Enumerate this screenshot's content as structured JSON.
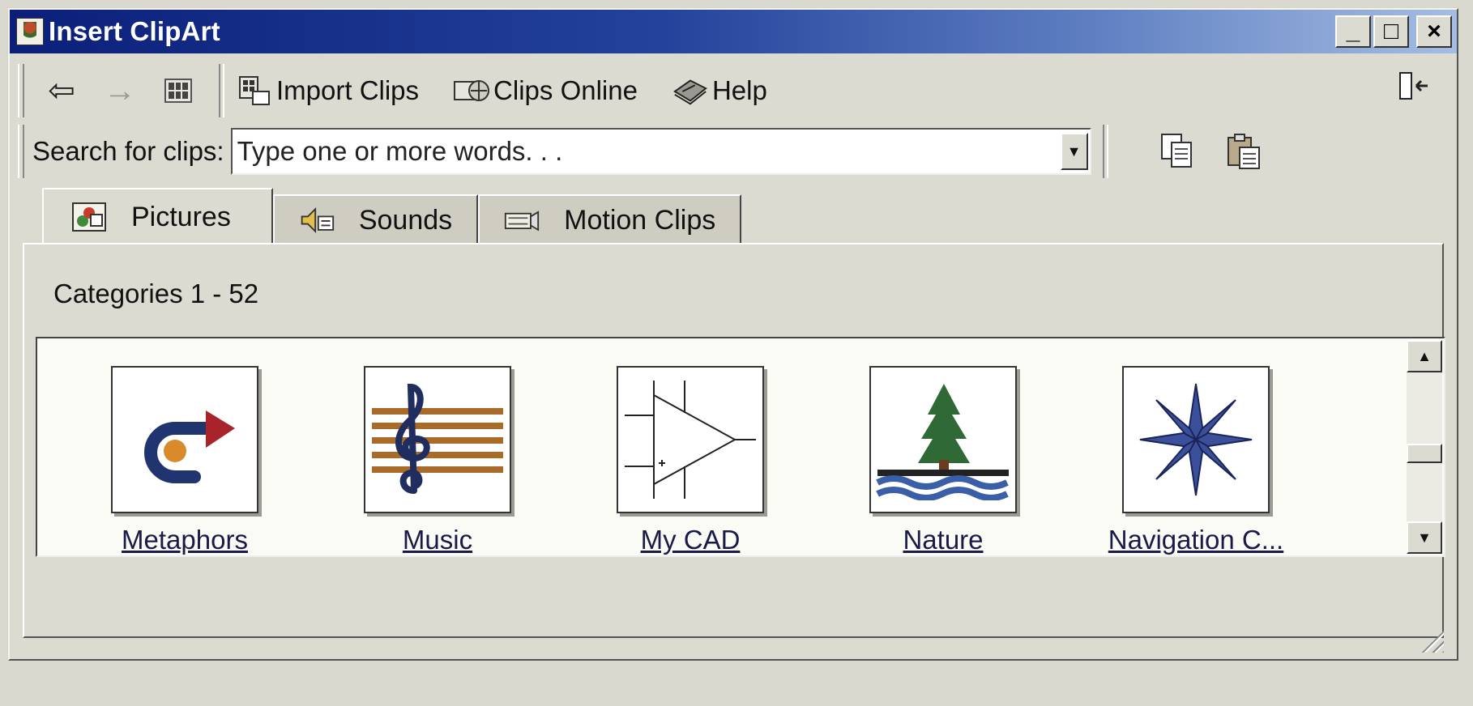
{
  "window": {
    "title": "Insert ClipArt",
    "controls": {
      "minimize": "_",
      "maximize": "□",
      "close": "×"
    }
  },
  "toolbar": {
    "back_icon": "back-arrow-icon",
    "forward_icon": "forward-arrow-icon",
    "all_categories_icon": "all-categories-icon",
    "import_label": "Import Clips",
    "online_label": "Clips Online",
    "help_label": "Help",
    "dock_icon": "change-to-small-window-icon"
  },
  "search": {
    "label": "Search for clips:",
    "placeholder": "Type one or more words. . .",
    "copy_icon": "copy-icon",
    "paste_icon": "paste-icon"
  },
  "tabs": [
    {
      "label": "Pictures",
      "icon": "pictures-icon",
      "active": true
    },
    {
      "label": "Sounds",
      "icon": "sounds-icon",
      "active": false
    },
    {
      "label": "Motion Clips",
      "icon": "motion-clips-icon",
      "active": false
    }
  ],
  "categories": {
    "range_label": "Categories 1 - 52",
    "items": [
      {
        "label": "Metaphors",
        "icon": "metaphors-icon"
      },
      {
        "label": "Music",
        "icon": "music-staff-icon"
      },
      {
        "label": "My CAD",
        "icon": "cad-amplifier-icon"
      },
      {
        "label": "Nature",
        "icon": "tree-water-icon"
      },
      {
        "label": "Navigation C...",
        "icon": "compass-star-icon"
      }
    ]
  },
  "scrollbar": {
    "position_fraction": 0.55
  },
  "colors": {
    "titlebar_start": "#0b1f7a",
    "titlebar_end": "#a5bde2",
    "face": "#dcdbd2",
    "link": "#1a1a4a"
  }
}
